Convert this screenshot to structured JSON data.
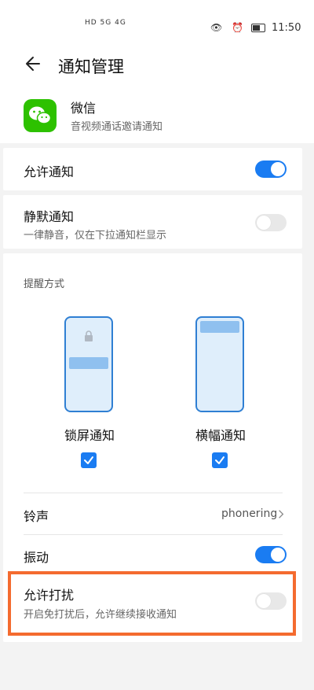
{
  "status_bar": {
    "network_label": "HD 5G 4G",
    "time": "11:50"
  },
  "header": {
    "title": "通知管理"
  },
  "app": {
    "name": "微信",
    "description": "音视频通话邀请通知",
    "icon": "wechat-icon",
    "brand_color": "#2DC100"
  },
  "allow_notifications": {
    "label": "允许通知",
    "enabled": true
  },
  "silent_notifications": {
    "label": "静默通知",
    "subtitle": "一律静音，仅在下拉通知栏显示",
    "enabled": false
  },
  "alert_style": {
    "section_label": "提醒方式",
    "options": [
      {
        "label": "锁屏通知",
        "checked": true
      },
      {
        "label": "横幅通知",
        "checked": true
      }
    ]
  },
  "ringtone": {
    "label": "铃声",
    "value": "phonering"
  },
  "vibration": {
    "label": "振动",
    "enabled": true
  },
  "allow_disturb": {
    "label": "允许打扰",
    "subtitle": "开启免打扰后，允许继续接收通知",
    "enabled": false
  },
  "colors": {
    "accent": "#1A7CF2",
    "highlight_border": "#F46B2F"
  }
}
